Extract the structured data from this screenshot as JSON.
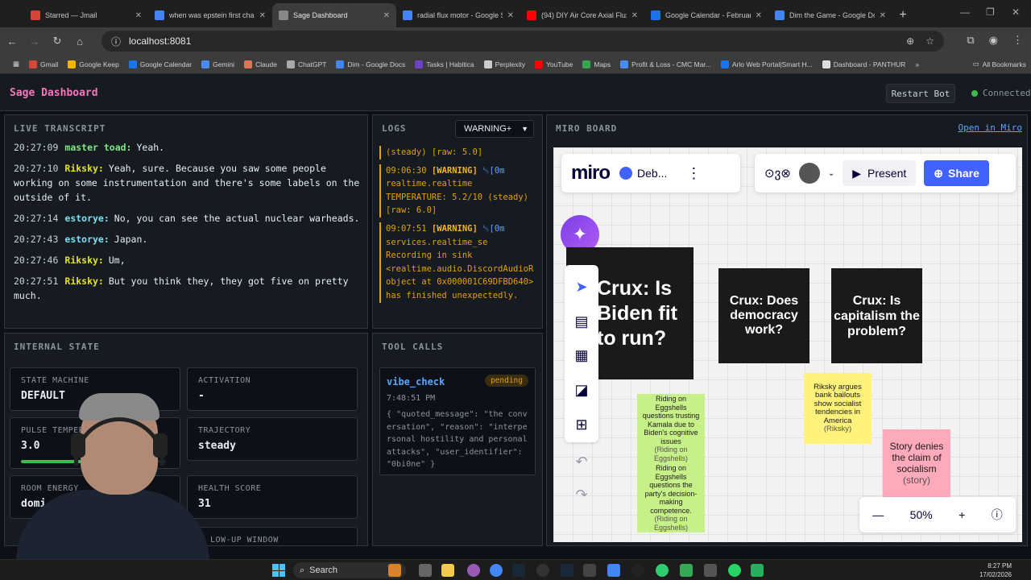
{
  "browser": {
    "tabs": [
      {
        "label": "Starred — Jmail",
        "color": "#d44638",
        "active": false
      },
      {
        "label": "when was epstein first charg",
        "color": "#4285f4",
        "active": false
      },
      {
        "label": "Sage Dashboard",
        "color": "#888888",
        "active": true
      },
      {
        "label": "radial flux motor - Google Se",
        "color": "#4285f4",
        "active": false
      },
      {
        "label": "(94) DIY Air Core Axial Flux",
        "color": "#ff0000",
        "active": false
      },
      {
        "label": "Google Calendar - February 2",
        "color": "#1a73e8",
        "active": false
      },
      {
        "label": "Dim the Game - Google Docs",
        "color": "#4285f4",
        "active": false
      }
    ],
    "url": "localhost:8081",
    "bookmarks": [
      {
        "label": "Gmail",
        "color": "#d44638"
      },
      {
        "label": "Google Keep",
        "color": "#f4b400"
      },
      {
        "label": "Google Calendar",
        "color": "#1a73e8"
      },
      {
        "label": "Gemini",
        "color": "#4a8af4"
      },
      {
        "label": "Claude",
        "color": "#d97757"
      },
      {
        "label": "ChatGPT",
        "color": "#aaaaaa"
      },
      {
        "label": "Dim - Google Docs",
        "color": "#4285f4"
      },
      {
        "label": "Tasks | Habitica",
        "color": "#6f42c1"
      },
      {
        "label": "Perplexity",
        "color": "#cccccc"
      },
      {
        "label": "YouTube",
        "color": "#ff0000"
      },
      {
        "label": "Maps",
        "color": "#34a853"
      },
      {
        "label": "Profit & Loss - CMC Mar...",
        "color": "#4a8af4"
      },
      {
        "label": "Arlo Web Portal|Smart H...",
        "color": "#1a73e8"
      },
      {
        "label": "Dashboard - PANTHUR",
        "color": "#dddddd"
      }
    ],
    "all_bookmarks": "All Bookmarks"
  },
  "app": {
    "title": "Sage Dashboard",
    "restart_label": "Restart Bot",
    "status": "Connected",
    "status_color": "#3fb950"
  },
  "transcript": {
    "title": "LIVE TRANSCRIPT",
    "lines": [
      {
        "time": "20:27:09",
        "speaker": "master toad:",
        "color": "#7ee787",
        "text": "Yeah."
      },
      {
        "time": "20:27:10",
        "speaker": "Riksky:",
        "color": "#e3e322",
        "text": "Yeah, sure. Because you saw some people working on some instrumentation and there's some labels on the outside of it."
      },
      {
        "time": "20:27:14",
        "speaker": "estorye:",
        "color": "#79e0f0",
        "text": "No, you can see the actual nuclear warheads."
      },
      {
        "time": "20:27:43",
        "speaker": "estorye:",
        "color": "#79e0f0",
        "text": "Japan."
      },
      {
        "time": "20:27:46",
        "speaker": "Riksky:",
        "color": "#e3e322",
        "text": "Um,"
      },
      {
        "time": "20:27:51",
        "speaker": "Riksky:",
        "color": "#e3e322",
        "text": "But you think they, they got five on pretty much."
      }
    ]
  },
  "logs": {
    "title": "LOGS",
    "filter": "WARNING+",
    "entries": [
      {
        "time": "",
        "level": "",
        "esc": "",
        "text": "(steady) [raw: 5.0]"
      },
      {
        "time": "09:06:30",
        "level": "[WARNING]",
        "esc": "␛[0m",
        "text": "realtime.realtime TEMPERATURE: 5.2/10 (steady) [raw: 6.0]"
      },
      {
        "time": "09:07:51",
        "level": "[WARNING]",
        "esc": "␛[0m",
        "text": "services.realtime_se Recording in sink <realtime.audio.DiscordAudioR object at 0x000001C69DFBD640> has finished unexpectedly."
      }
    ]
  },
  "miro": {
    "title": "MIRO BOARD",
    "open_label": "Open in Miro",
    "logo": "miro",
    "board_name": "Deb...",
    "reactions": "⊙ვ⊗",
    "present": "Present",
    "share": "Share",
    "zoom": "50%",
    "cards": [
      {
        "text": "Crux: Is Biden fit to run?"
      },
      {
        "text": "Crux: Does democracy work?"
      },
      {
        "text": "Crux: Is capitalism the problem?"
      }
    ],
    "stickies": [
      {
        "text": "Riding on Eggshells questions trusting Kamala due to Biden's cognitive issues",
        "src": "(Riding on Eggshells)",
        "color": "#c8f088"
      },
      {
        "text": "Riding on Eggshells questions the party's decision-making competence.",
        "src": "(Riding on Eggshells)",
        "color": "#c8f088"
      },
      {
        "text": "Riksky argues bank bailouts show socialist tendencies in America",
        "src": "(Riksky)",
        "color": "#fff27a"
      },
      {
        "text": "Story denies the claim of socialism",
        "src": "(story)",
        "color": "#ffaabb"
      }
    ]
  },
  "internal_state": {
    "title": "INTERNAL STATE",
    "cards": [
      {
        "label": "STATE MACHINE",
        "value": "DEFAULT"
      },
      {
        "label": "ACTIVATION",
        "value": "-"
      },
      {
        "label": "PULSE TEMPER",
        "value": "3.0",
        "progress": 0.3
      },
      {
        "label": "TRAJECTORY",
        "value": "steady"
      },
      {
        "label": "ROOM ENERGY",
        "value": "domi"
      },
      {
        "label": "HEALTH SCORE",
        "value": "31"
      },
      {
        "label": "",
        "value": ""
      },
      {
        "label": "LOW-UP WINDOW",
        "value": ""
      }
    ]
  },
  "tool_calls": {
    "title": "TOOL CALLS",
    "calls": [
      {
        "name": "vibe_check",
        "status": "pending",
        "time": "7:48:51 PM",
        "body": "{ \"quoted_message\": \"the conversation\", \"reason\": \"interpersonal hostility and personal attacks\", \"user_identifier\": \"0bi0ne\" }"
      }
    ]
  },
  "taskbar": {
    "search": "Search",
    "time": "8:27 PM",
    "date": "17/02/2026"
  }
}
